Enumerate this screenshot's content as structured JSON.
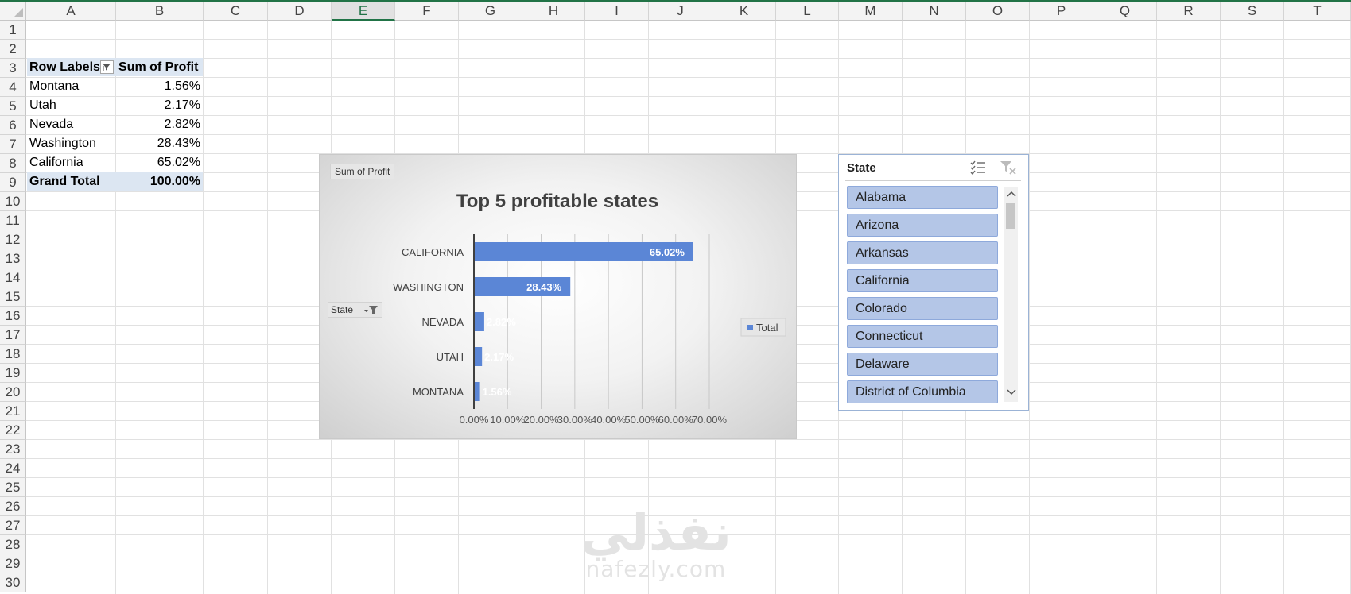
{
  "columns": [
    "A",
    "B",
    "C",
    "D",
    "E",
    "F",
    "G",
    "H",
    "I",
    "J",
    "K",
    "L",
    "M",
    "N",
    "O",
    "P",
    "Q",
    "R",
    "S",
    "T"
  ],
  "selected_column": "E",
  "rows": [
    "1",
    "2",
    "3",
    "4",
    "5",
    "6",
    "7",
    "8",
    "9",
    "10",
    "11",
    "12",
    "13",
    "14",
    "15",
    "16",
    "17",
    "18",
    "19",
    "20",
    "21",
    "22",
    "23",
    "24",
    "25",
    "26",
    "27",
    "28",
    "29",
    "30"
  ],
  "pivot": {
    "header_row_labels": "Row Labels",
    "header_value": "Sum of Profit",
    "rows": [
      {
        "label": "Montana",
        "value": "1.56%"
      },
      {
        "label": "Utah",
        "value": "2.17%"
      },
      {
        "label": "Nevada",
        "value": "2.82%"
      },
      {
        "label": "Washington",
        "value": "28.43%"
      },
      {
        "label": "California",
        "value": "65.02%"
      }
    ],
    "grand_total_label": "Grand Total",
    "grand_total_value": "100.00%"
  },
  "chart_field_buttons": {
    "value_field": "Sum of Profit",
    "axis_field": "State"
  },
  "chart_data": {
    "type": "bar",
    "orientation": "horizontal",
    "title": "Top 5 profitable states",
    "categories": [
      "CALIFORNIA",
      "WASHINGTON",
      "NEVADA",
      "UTAH",
      "MONTANA"
    ],
    "series": [
      {
        "name": "Total",
        "values": [
          65.02,
          28.43,
          2.82,
          2.17,
          1.56
        ]
      }
    ],
    "data_labels": [
      "65.02%",
      "28.43%",
      "2.82%",
      "2.17%",
      "1.56%"
    ],
    "x_ticks": [
      "0.00%",
      "10.00%",
      "20.00%",
      "30.00%",
      "40.00%",
      "50.00%",
      "60.00%",
      "70.00%"
    ],
    "xlim": [
      0,
      70
    ],
    "grid": true,
    "legend": "right",
    "bar_color": "#5b86d6"
  },
  "slicer": {
    "title": "State",
    "items": [
      "Alabama",
      "Arizona",
      "Arkansas",
      "California",
      "Colorado",
      "Connecticut",
      "Delaware",
      "District of Columbia"
    ]
  },
  "watermark": {
    "arabic": "نفذلي",
    "latin": "nafezly.com"
  }
}
